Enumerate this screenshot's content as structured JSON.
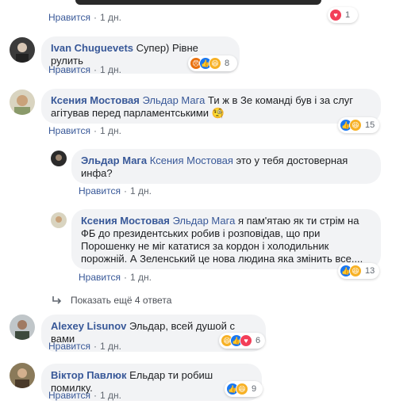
{
  "ui": {
    "like": "Нравится",
    "dot": "·",
    "show_more": "Показать ещё 4 ответа"
  },
  "comments": [
    {
      "time": "1 дн.",
      "reaction_count": "1",
      "reactions": [
        "love"
      ]
    },
    {
      "author": "Ivan Chuguevets",
      "text": "Супер) Рівне рулить",
      "time": "1 дн.",
      "reaction_count": "8",
      "reactions": [
        "angry",
        "like",
        "haha"
      ]
    },
    {
      "author": "Ксения Мостовая",
      "mention": "Эльдар Мага",
      "text": "Ти ж в Зе команді був і за слуг агітував перед парламентськими 🧐",
      "time": "1 дн.",
      "reaction_count": "15",
      "reactions": [
        "like",
        "haha"
      ]
    },
    {
      "author": "Эльдар Мага",
      "mention": "Ксения Мостовая",
      "text": "это у тебя достоверная инфа?",
      "time": "1 дн.",
      "reactions": []
    },
    {
      "author": "Ксения Мостовая",
      "mention": "Эльдар Мага",
      "text": "я пам'ятаю як ти стрім на ФБ до президентських робив і розповідав, що при Порошенку не міг кататися за кордон і холодильник порожній. А Зеленський це нова людина яка змінить все....",
      "time": "1 дн.",
      "reaction_count": "13",
      "reactions": [
        "like",
        "haha"
      ]
    },
    {
      "author": "Alexey Lisunov",
      "text": "Эльдар, всей душой с вами",
      "time": "1 дн.",
      "reaction_count": "6",
      "reactions": [
        "haha",
        "like",
        "love"
      ]
    },
    {
      "author": "Віктор Павлюк",
      "text": "Ельдар ти робиш помилку.",
      "time": "1 дн.",
      "reaction_count": "9",
      "reactions": [
        "like",
        "haha"
      ]
    }
  ],
  "colors": {
    "link": "#385898",
    "bubble": "#f2f3f5",
    "like": "#1877f2",
    "haha": "#f7b125",
    "angry": "#e9710f",
    "love": "#f33e58"
  }
}
